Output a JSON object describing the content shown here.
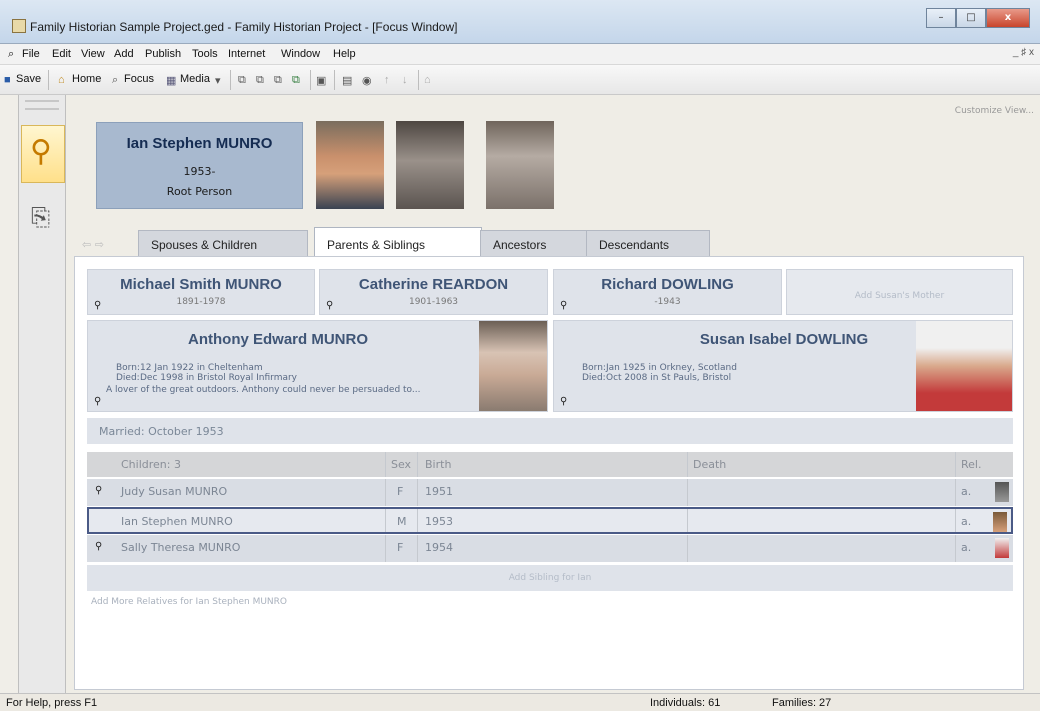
{
  "window": {
    "title": "Family Historian Sample Project.ged - Family Historian Project - [Focus Window]",
    "buttons": [
      "–",
      "□",
      "x"
    ]
  },
  "menu": {
    "items": [
      "File",
      "Edit",
      "View",
      "Add",
      "Publish",
      "Tools",
      "Internet",
      "Window",
      "Help"
    ],
    "mdi": "_ ♯ x"
  },
  "toolbar": {
    "save": "Save",
    "home": "Home",
    "focus": "Focus",
    "media": "Media"
  },
  "customize": "Customize View...",
  "root": {
    "name": "Ian Stephen MUNRO",
    "dates": "1953-",
    "label": "Root Person"
  },
  "tabs": [
    "Spouses & Children",
    "Parents & Siblings",
    "Ancestors",
    "Descendants"
  ],
  "grandparents": [
    {
      "name": "Michael Smith MUNRO",
      "dates": "1891-1978"
    },
    {
      "name": "Catherine REARDON",
      "dates": "1901-1963"
    },
    {
      "name": "Richard DOWLING",
      "dates": "-1943"
    },
    {
      "add": "Add Susan's Mother"
    }
  ],
  "father": {
    "name": "Anthony Edward MUNRO",
    "born_label": "Born:",
    "born": "12 Jan 1922 in Cheltenham",
    "died_label": "Died:",
    "died": "Dec 1998 in Bristol Royal Infirmary",
    "note": "A lover of the great outdoors. Anthony could never be persuaded to..."
  },
  "mother": {
    "name": "Susan Isabel DOWLING",
    "born_label": "Born:",
    "born": "Jan 1925 in Orkney, Scotland",
    "died_label": "Died:",
    "died": "Oct 2008 in St Pauls, Bristol"
  },
  "married": "Married: October 1953",
  "children": {
    "headers": {
      "name": "Children: 3",
      "sex": "Sex",
      "birth": "Birth",
      "death": "Death",
      "rel": "Rel."
    },
    "rows": [
      {
        "name": "Judy Susan MUNRO",
        "sex": "F",
        "birth": "1951",
        "death": "",
        "rel": "a."
      },
      {
        "name": "Ian Stephen MUNRO",
        "sex": "M",
        "birth": "1953",
        "death": "",
        "rel": "a."
      },
      {
        "name": "Sally Theresa MUNRO",
        "sex": "F",
        "birth": "1954",
        "death": "",
        "rel": "a."
      }
    ]
  },
  "add_sibling": "Add Sibling for Ian",
  "add_more": "Add More Relatives for Ian Stephen MUNRO",
  "status": {
    "help": "For Help, press F1",
    "individuals": "Individuals: 61",
    "families": "Families: 27"
  }
}
